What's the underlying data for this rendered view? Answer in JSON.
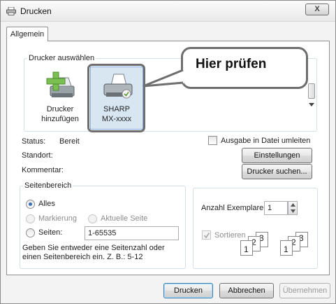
{
  "window": {
    "title": "Drucken",
    "close_label": "X"
  },
  "tabs": [
    {
      "label": "Allgemein"
    }
  ],
  "printer_group": {
    "legend": "Drucker auswählen",
    "items": [
      {
        "line1": "Drucker",
        "line2": "hinzufügen"
      },
      {
        "line1": "SHARP",
        "line2": "MX-xxxx"
      }
    ]
  },
  "callout": {
    "text": "Hier prüfen"
  },
  "status": {
    "status_label": "Status:",
    "status_value": "Bereit",
    "location_label": "Standort:",
    "comment_label": "Kommentar:",
    "print_to_file_label": "Ausgabe in Datei umleiten",
    "settings_button": "Einstellungen",
    "find_printer_button": "Drucker suchen..."
  },
  "page_range": {
    "legend": "Seitenbereich",
    "all_label": "Alles",
    "selection_label": "Markierung",
    "current_page_label": "Aktuelle Seite",
    "pages_label": "Seiten:",
    "pages_value": "1-65535",
    "hint_line1": "Geben Sie entweder eine Seitenzahl oder",
    "hint_line2": "einen Seitenbereich ein. Z. B.: 5-12"
  },
  "copies": {
    "label": "Anzahl Exemplare:",
    "value": "1",
    "collate_label": "Sortieren",
    "collate_digits": [
      "1",
      "2",
      "3"
    ]
  },
  "footer": {
    "print_button": "Drucken",
    "cancel_button": "Abbrechen",
    "apply_button": "Übernehmen"
  }
}
